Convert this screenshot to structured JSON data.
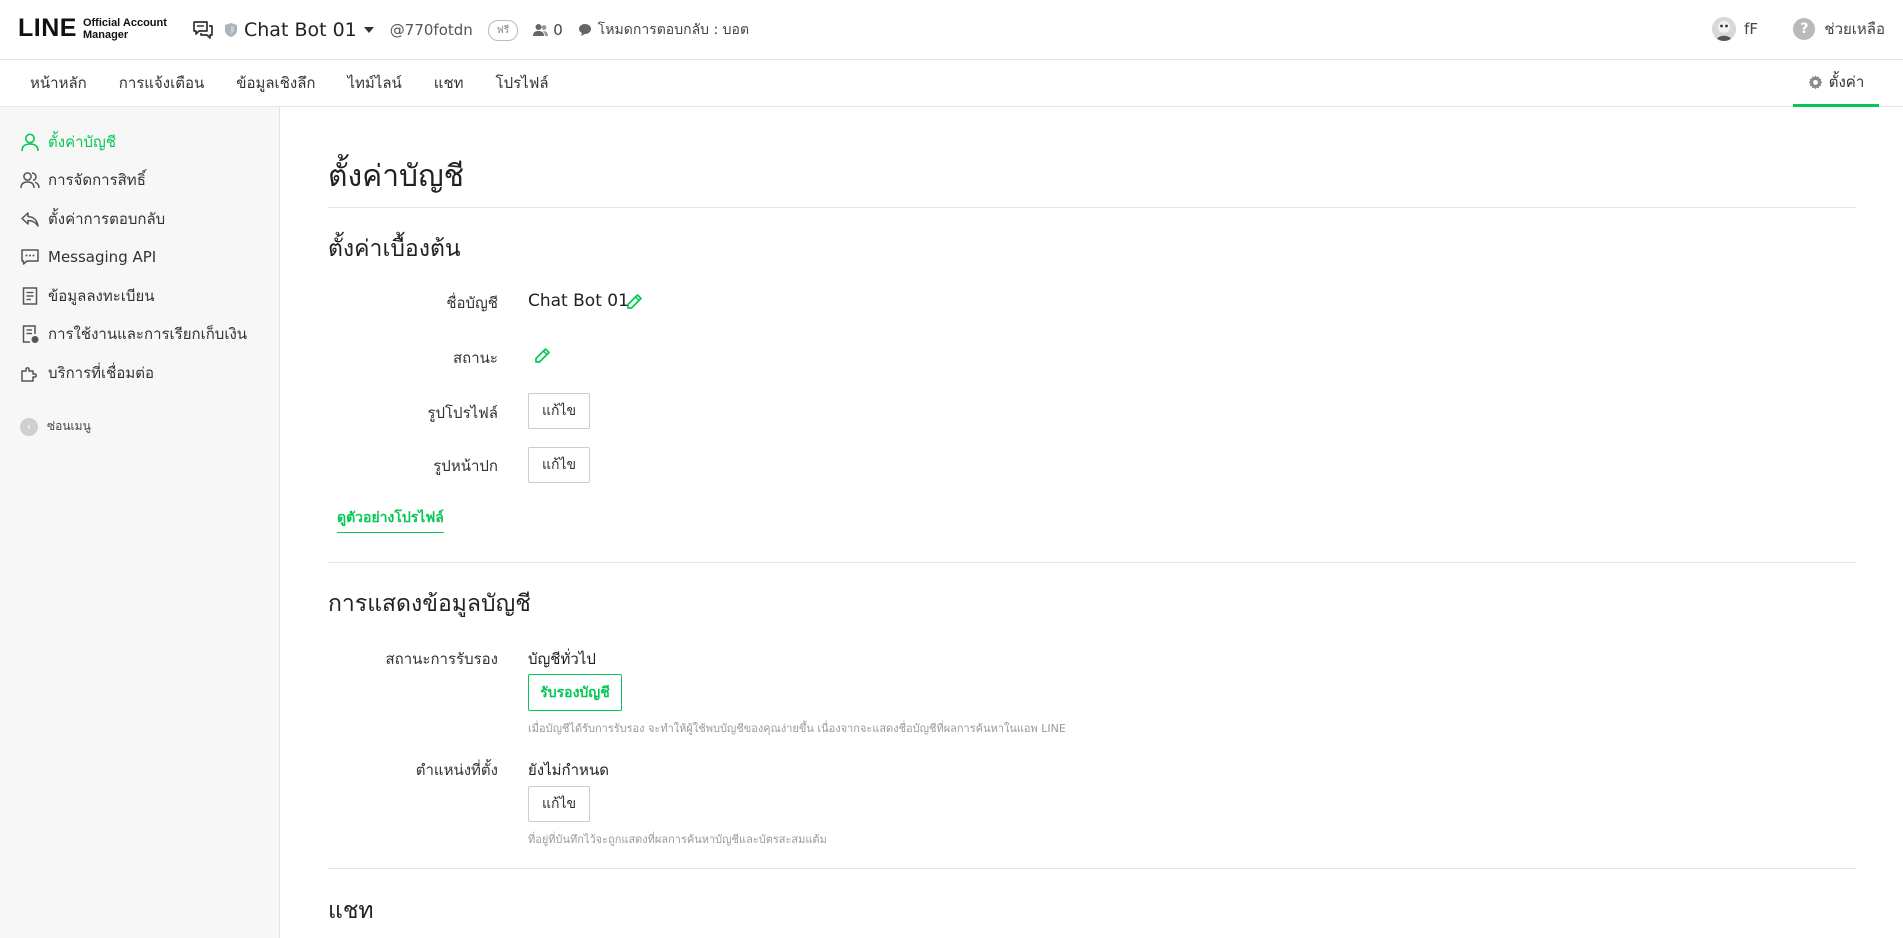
{
  "header": {
    "logo_main": "LINE",
    "logo_sub_1": "Official Account",
    "logo_sub_2": "Manager",
    "account_name": "Chat Bot 01",
    "account_id": "@770fotdn",
    "plan_badge": "ฟรี",
    "friend_count": "0",
    "response_mode": "โหมดการตอบกลับ : บอต",
    "user_name": "fF",
    "help_label": "ช่วยเหลือ"
  },
  "tabs": [
    "หน้าหลัก",
    "การแจ้งเตือน",
    "ข้อมูลเชิงลึก",
    "ไทม์ไลน์",
    "แชท",
    "โปรไฟล์"
  ],
  "settings_tab": "ตั้งค่า",
  "sidebar": {
    "items": [
      {
        "label": "ตั้งค่าบัญชี",
        "icon": "user-icon",
        "active": true
      },
      {
        "label": "การจัดการสิทธิ์",
        "icon": "users-icon",
        "active": false
      },
      {
        "label": "ตั้งค่าการตอบกลับ",
        "icon": "reply-icon",
        "active": false
      },
      {
        "label": "Messaging API",
        "icon": "message-dots-icon",
        "active": false
      },
      {
        "label": "ข้อมูลลงทะเบียน",
        "icon": "document-icon",
        "active": false
      },
      {
        "label": "การใช้งานและการเรียกเก็บเงิน",
        "icon": "billing-icon",
        "active": false
      },
      {
        "label": "บริการที่เชื่อมต่อ",
        "icon": "puzzle-icon",
        "active": false
      }
    ],
    "collapse_label": "ซ่อนเมนู"
  },
  "main": {
    "page_title": "ตั้งค่าบัญชี",
    "basic": {
      "title": "ตั้งค่าเบื้องต้น",
      "name_label": "ชื่อบัญชี",
      "name_value": "Chat Bot 01",
      "status_label": "สถานะ",
      "profile_image_label": "รูปโปรไฟล์",
      "cover_image_label": "รูปหน้าปก",
      "edit_label": "แก้ไข",
      "preview_link": "ดูตัวอย่างโปรไฟล์"
    },
    "display": {
      "title": "การแสดงข้อมูลบัญชี",
      "verify_label": "สถานะการรับรอง",
      "verify_value": "บัญชีทั่วไป",
      "verify_button": "รับรองบัญชี",
      "verify_note": "เมื่อบัญชีได้รับการรับรอง จะทำให้ผู้ใช้พบบัญชีของคุณง่ายขึ้น เนื่องจากจะแสดงชื่อบัญชีที่ผลการค้นหาในแอพ LINE",
      "location_label": "ตำแหน่งที่ตั้ง",
      "location_value": "ยังไม่กำหนด",
      "edit_label": "แก้ไข",
      "location_note": "ที่อยู่ที่บันทึกไว้จะถูกแสดงที่ผลการค้นหาบัญชีและบัตรสะสมแต้ม"
    },
    "chat": {
      "title": "แชท"
    }
  },
  "colors": {
    "accent": "#06c755",
    "sidebar_bg": "#f7f7f7",
    "border": "#e5e5e5"
  }
}
